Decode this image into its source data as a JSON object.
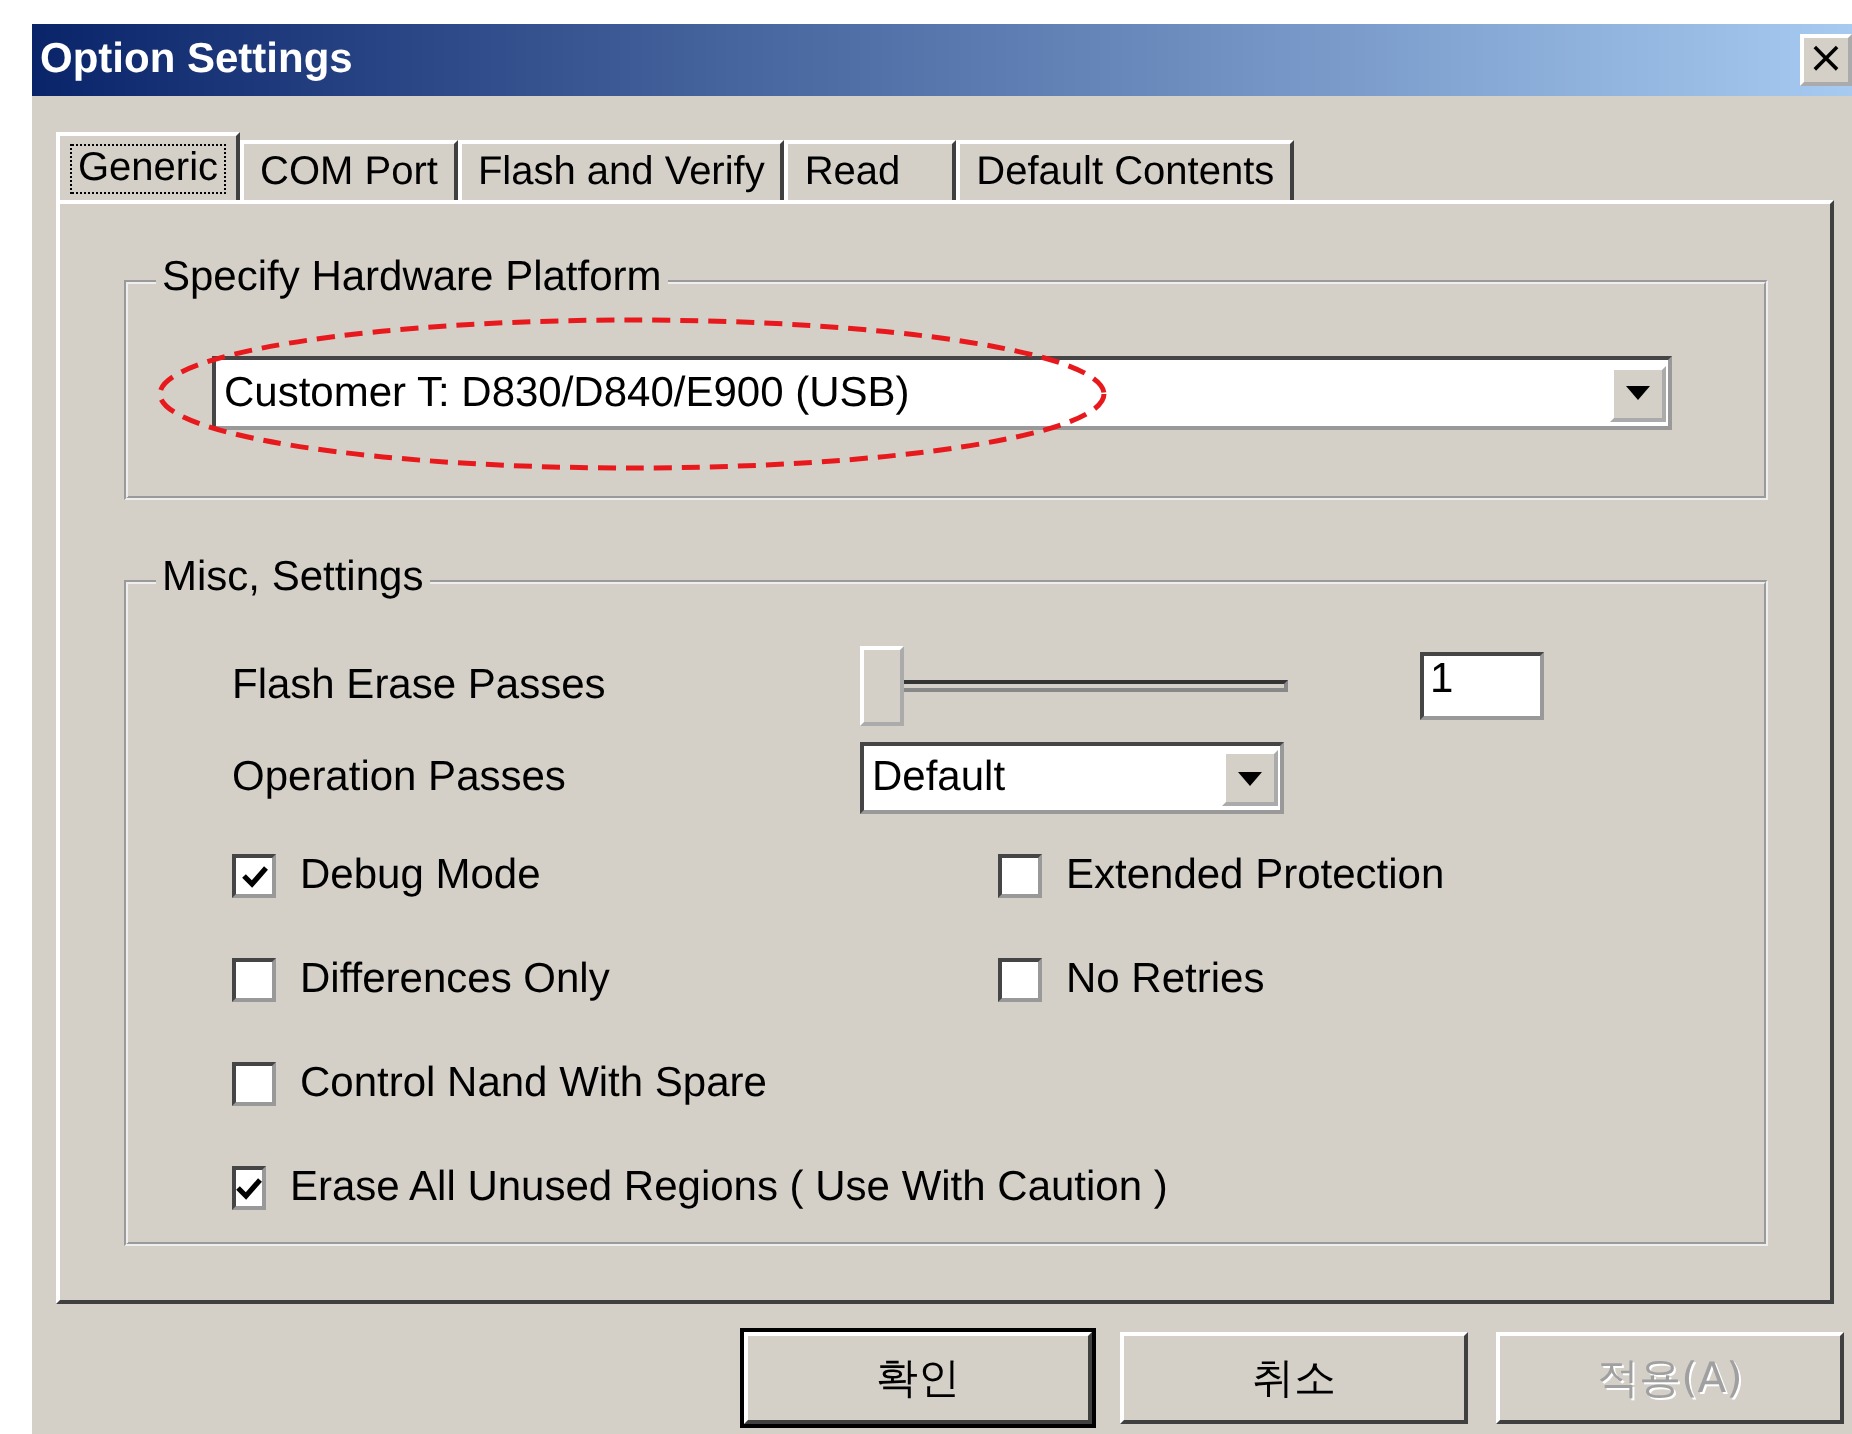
{
  "window": {
    "title": "Option Settings",
    "close": "×"
  },
  "tabs": [
    {
      "label": "Generic",
      "selected": true
    },
    {
      "label": "COM Port",
      "selected": false
    },
    {
      "label": "Flash and Verify",
      "selected": false
    },
    {
      "label": "Read",
      "selected": false
    },
    {
      "label": "Default Contents",
      "selected": false
    }
  ],
  "hardware_group": {
    "title": "Specify Hardware Platform",
    "platform": {
      "value": "Customer T: D830/D840/E900 (USB)",
      "highlighted": true
    }
  },
  "misc_group": {
    "title": "Misc, Settings",
    "flash_erase_passes": {
      "label": "Flash Erase Passes",
      "level": 0,
      "value": "1"
    },
    "operation_passes": {
      "label": "Operation Passes",
      "value": "Default"
    },
    "checkbox_rows": [
      [
        {
          "label": "Debug Mode",
          "checked": true
        },
        {
          "label": "Extended Protection",
          "checked": false
        }
      ],
      [
        {
          "label": "Differences Only",
          "checked": false
        },
        {
          "label": "No Retries",
          "checked": false
        }
      ],
      [
        {
          "label": "Control Nand With Spare",
          "checked": false
        }
      ],
      [
        {
          "label": "Erase All Unused Regions ( Use With Caution )",
          "checked": true
        }
      ]
    ]
  },
  "buttons": [
    {
      "label": "확인",
      "default": true,
      "disabled": false
    },
    {
      "label": "취소",
      "default": false,
      "disabled": false
    },
    {
      "label": "적용(A)",
      "default": false,
      "disabled": true
    }
  ]
}
